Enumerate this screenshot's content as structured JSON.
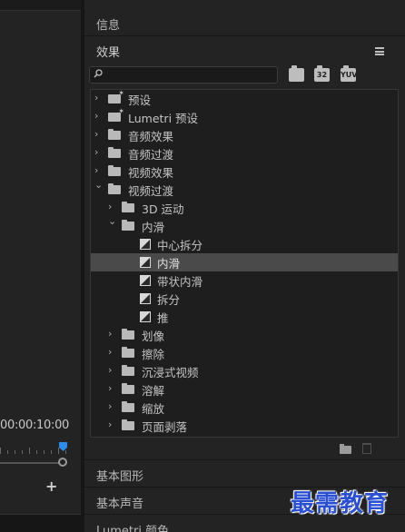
{
  "program_monitor": {
    "timecode": "00:00:10:00"
  },
  "info_panel": {
    "title": "信息"
  },
  "effects_panel": {
    "title": "效果",
    "search": {
      "value": "",
      "placeholder": ""
    },
    "toolbar": {
      "accelerated_label": "",
      "bit_depth_label": "32",
      "yuv_label": "YUV"
    },
    "tree": [
      {
        "label": "预设",
        "type": "star-folder",
        "expanded": false,
        "level": 0
      },
      {
        "label": "Lumetri 预设",
        "type": "star-folder",
        "expanded": false,
        "level": 0
      },
      {
        "label": "音频效果",
        "type": "folder",
        "expanded": false,
        "level": 0
      },
      {
        "label": "音频过渡",
        "type": "folder",
        "expanded": false,
        "level": 0
      },
      {
        "label": "视频效果",
        "type": "folder",
        "expanded": false,
        "level": 0
      },
      {
        "label": "视频过渡",
        "type": "folder",
        "expanded": true,
        "level": 0
      },
      {
        "label": "3D 运动",
        "type": "folder",
        "expanded": false,
        "level": 1
      },
      {
        "label": "内滑",
        "type": "folder",
        "expanded": true,
        "level": 1
      },
      {
        "label": "中心拆分",
        "type": "transition",
        "level": 2
      },
      {
        "label": "内滑",
        "type": "transition",
        "level": 2,
        "selected": true
      },
      {
        "label": "带状内滑",
        "type": "transition",
        "level": 2
      },
      {
        "label": "拆分",
        "type": "transition",
        "level": 2
      },
      {
        "label": "推",
        "type": "transition",
        "level": 2
      },
      {
        "label": "划像",
        "type": "folder",
        "expanded": false,
        "level": 1
      },
      {
        "label": "擦除",
        "type": "folder",
        "expanded": false,
        "level": 1
      },
      {
        "label": "沉浸式视频",
        "type": "folder",
        "expanded": false,
        "level": 1
      },
      {
        "label": "溶解",
        "type": "folder",
        "expanded": false,
        "level": 1
      },
      {
        "label": "缩放",
        "type": "folder",
        "expanded": false,
        "level": 1
      },
      {
        "label": "页面剥落",
        "type": "folder",
        "expanded": false,
        "level": 1
      }
    ]
  },
  "lower_panels": [
    {
      "title": "基本图形"
    },
    {
      "title": "基本声音"
    },
    {
      "title": "Lumetri 颜色"
    }
  ],
  "watermark": {
    "text": "最需教育"
  },
  "colors": {
    "playhead": "#2d8ceb",
    "selection": "#4a4a4a",
    "watermark": "#2a4fd0"
  }
}
